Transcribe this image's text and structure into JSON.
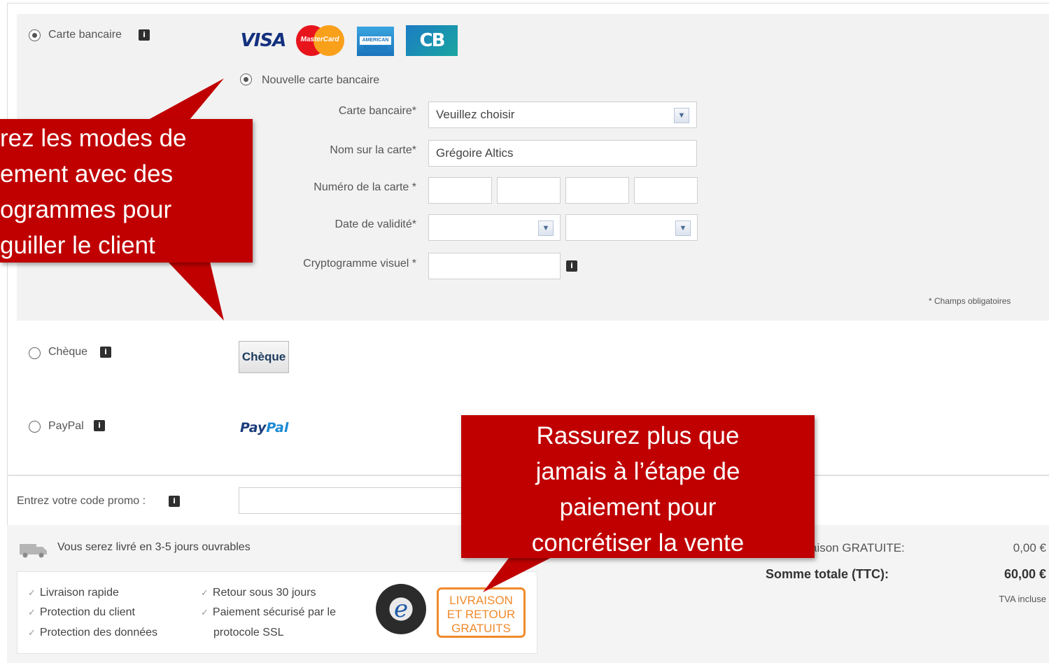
{
  "payment": {
    "card": {
      "label": "Carte bancaire",
      "new_card_label": "Nouvelle carte bancaire",
      "logos": [
        "VISA",
        "MasterCard",
        "American Express",
        "CB"
      ],
      "fields": {
        "type_label": "Carte bancaire*",
        "type_value": "Veuillez choisir",
        "name_label": "Nom sur la carte*",
        "name_value": "Grégoire Altics",
        "number_label": "Numéro de la carte *",
        "expiry_label": "Date de validité*",
        "cvv_label": "Cryptogramme visuel *"
      },
      "required_note": "* Champs obligatoires"
    },
    "cheque": {
      "label": "Chèque",
      "button": "Chèque"
    },
    "paypal": {
      "label": "PayPal",
      "logo_pay": "Pay",
      "logo_pal": "Pal"
    }
  },
  "promo": {
    "label": "Entrez votre code promo :"
  },
  "delivery": {
    "text": "Vous serez livré en 3-5 jours ouvrables"
  },
  "guarantees": {
    "col1": [
      "Livraison rapide",
      "Protection du client",
      "Protection des données"
    ],
    "col2_line1": "Retour sous 30 jours",
    "col2_line2": "Paiement sécurisé par le",
    "col2_line3": "protocole SSL",
    "badge_lines": [
      "LIVRAISON",
      "ET RETOUR",
      "GRATUITS"
    ]
  },
  "totals": {
    "shipping_label": "aison GRATUITE:",
    "shipping_value": "0,00 €",
    "total_label": "Somme totale (TTC):",
    "total_value": "60,00 €",
    "vat_note": "TVA incluse"
  },
  "callouts": {
    "left_lines": [
      "rez les modes de",
      "ement avec des",
      "ogrammes pour",
      "guiller le client"
    ],
    "right_lines": [
      "Rassurez plus que",
      "jamais à l’étape de",
      "paiement pour",
      "concrétiser la vente"
    ]
  },
  "icons": {
    "info": "info-icon",
    "truck": "truck-icon",
    "check": "check-icon",
    "select_arrow": "chevron-down-icon"
  }
}
